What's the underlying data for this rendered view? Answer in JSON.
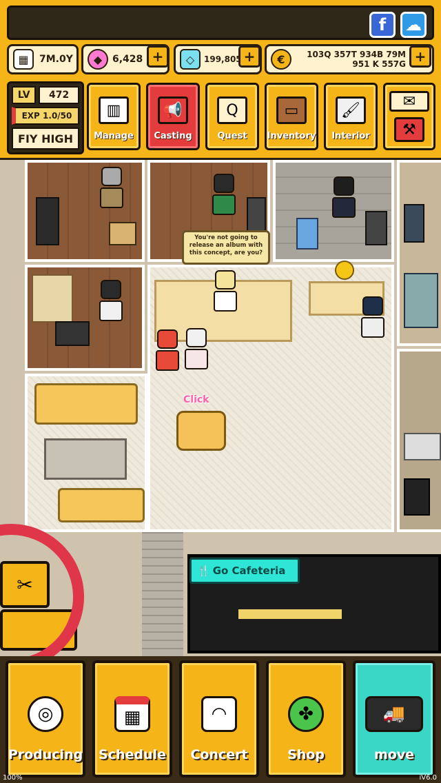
{
  "hud": {
    "social": {
      "facebook": "f",
      "chat": "☁"
    },
    "resources": {
      "time": "7M.0Y",
      "gems_pink": "6,428",
      "gems_blue": "199,805",
      "coins": "103Q 357T 934B 79M 951 K 557G"
    },
    "plus": "+",
    "level": {
      "lv_label": "LV",
      "lv_value": "472",
      "exp": "EXP 1.0/50",
      "grade": "FIY HIGH"
    },
    "menu": {
      "manage": "Manage",
      "casting": "Casting",
      "quest": "Quest",
      "inventory": "Inventory",
      "interior": "Interior"
    }
  },
  "world": {
    "speech": "You're not going to release an album with this concept, are you?",
    "click": "Click",
    "cafeteria": "Go Cafeteria"
  },
  "bottom": {
    "producing": "Producing",
    "schedule": "Schedule",
    "concert": "Concert",
    "shop": "Shop",
    "move": "move",
    "zoom": "100%",
    "version": "iV6.0"
  }
}
